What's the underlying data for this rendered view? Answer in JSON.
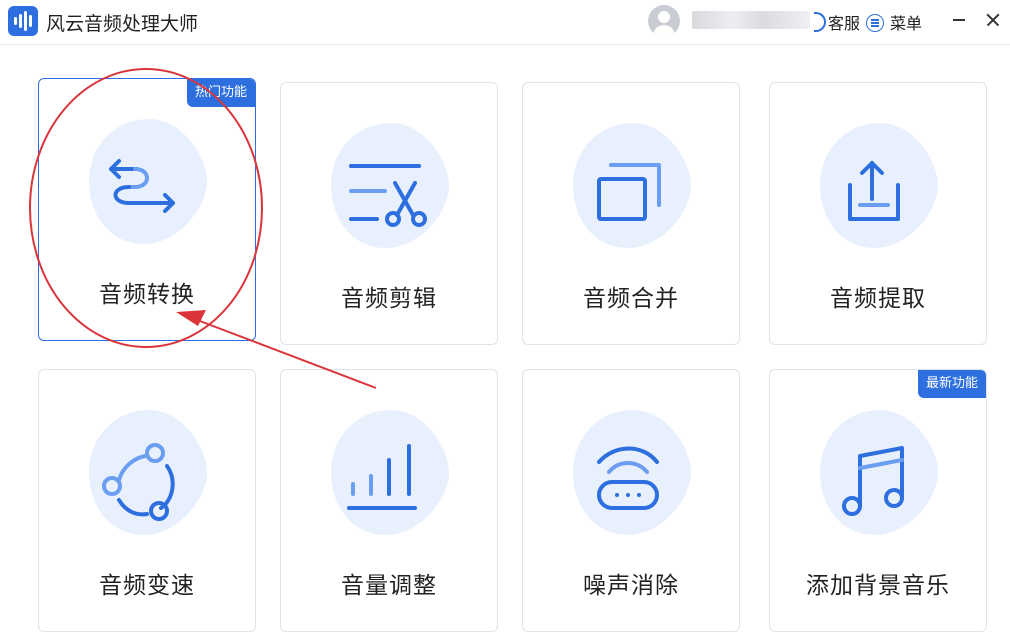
{
  "app": {
    "title": "风云音频处理大师"
  },
  "header": {
    "service_label": "客服",
    "menu_label": "菜单"
  },
  "cards": [
    {
      "label": "音频转换",
      "badge": "热门功能",
      "icon": "convert-arrows-icon",
      "selected": true
    },
    {
      "label": "音频剪辑",
      "icon": "scissors-icon"
    },
    {
      "label": "音频合并",
      "icon": "merge-windows-icon"
    },
    {
      "label": "音频提取",
      "icon": "upload-tray-icon"
    },
    {
      "label": "音频变速",
      "icon": "speed-circle-icon"
    },
    {
      "label": "音量调整",
      "icon": "volume-bars-icon"
    },
    {
      "label": "噪声消除",
      "icon": "noise-router-icon"
    },
    {
      "label": "添加背景音乐",
      "badge": "最新功能",
      "icon": "music-note-icon"
    }
  ],
  "colors": {
    "accent": "#2e6fe0",
    "icon_bg": "#e8f0fd",
    "annotation": "#d9353a"
  }
}
